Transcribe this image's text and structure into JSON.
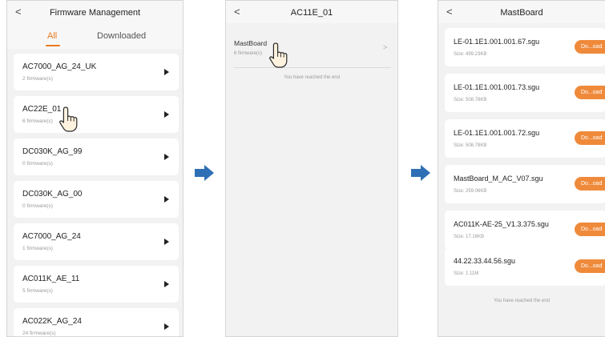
{
  "screen1": {
    "back_icon": "chevron-left",
    "title": "Firmware Management",
    "tabs": [
      {
        "label": "All",
        "active": true
      },
      {
        "label": "Downloaded",
        "active": false
      }
    ],
    "items": [
      {
        "name": "AC7000_AG_24_UK",
        "count": "2 firmware(s)"
      },
      {
        "name": "AC22E_01",
        "count": "6 firmware(s)"
      },
      {
        "name": "DC030K_AG_99",
        "count": "0 firmware(s)"
      },
      {
        "name": "DC030K_AG_00",
        "count": "0 firmware(s)"
      },
      {
        "name": "AC7000_AG_24",
        "count": "1 firmware(s)"
      },
      {
        "name": "AC011K_AE_11",
        "count": "5 firmware(s)"
      },
      {
        "name": "AC022K_AG_24",
        "count": "24 firmware(s)"
      }
    ]
  },
  "screen2": {
    "back_icon": "chevron-left",
    "title": "AC11E_01",
    "item": {
      "name": "MastBoard",
      "count": "6 firmware(s)"
    },
    "end_text": "You have reached the end"
  },
  "screen3": {
    "back_icon": "chevron-left",
    "title": "MastBoard",
    "files": [
      {
        "name": "LE-01.1E1.001.001.67.sgu",
        "size": "Size: 499.23KB",
        "button": "Do...oad"
      },
      {
        "name": "LE-01.1E1.001.001.73.sgu",
        "size": "Size: 508.78KB",
        "button": "Do...oad"
      },
      {
        "name": "LE-01.1E1.001.001.72.sgu",
        "size": "Size: 508.78KB",
        "button": "Do...oad"
      },
      {
        "name": "MastBoard_M_AC_V07.sgu",
        "size": "Size: 259.06KB",
        "button": "Do...oad"
      },
      {
        "name": "AC011K-AE-25_V1.3.375.sgu",
        "size": "Size: 17.16KB",
        "button": "Do...oad"
      },
      {
        "name": "44.22.33.44.56.sgu",
        "size": "Size: 1.11M",
        "button": "Do...oad"
      }
    ],
    "end_text": "You have reached the end"
  },
  "colors": {
    "accent": "#e8791c",
    "button": "#ef8a3b",
    "arrow": "#2f6fb5",
    "background": "#f2f2f2"
  },
  "icons": [
    "chevron-left-icon",
    "play-icon",
    "chevron-right-icon",
    "hand-pointer-icon",
    "arrow-right-icon"
  ]
}
